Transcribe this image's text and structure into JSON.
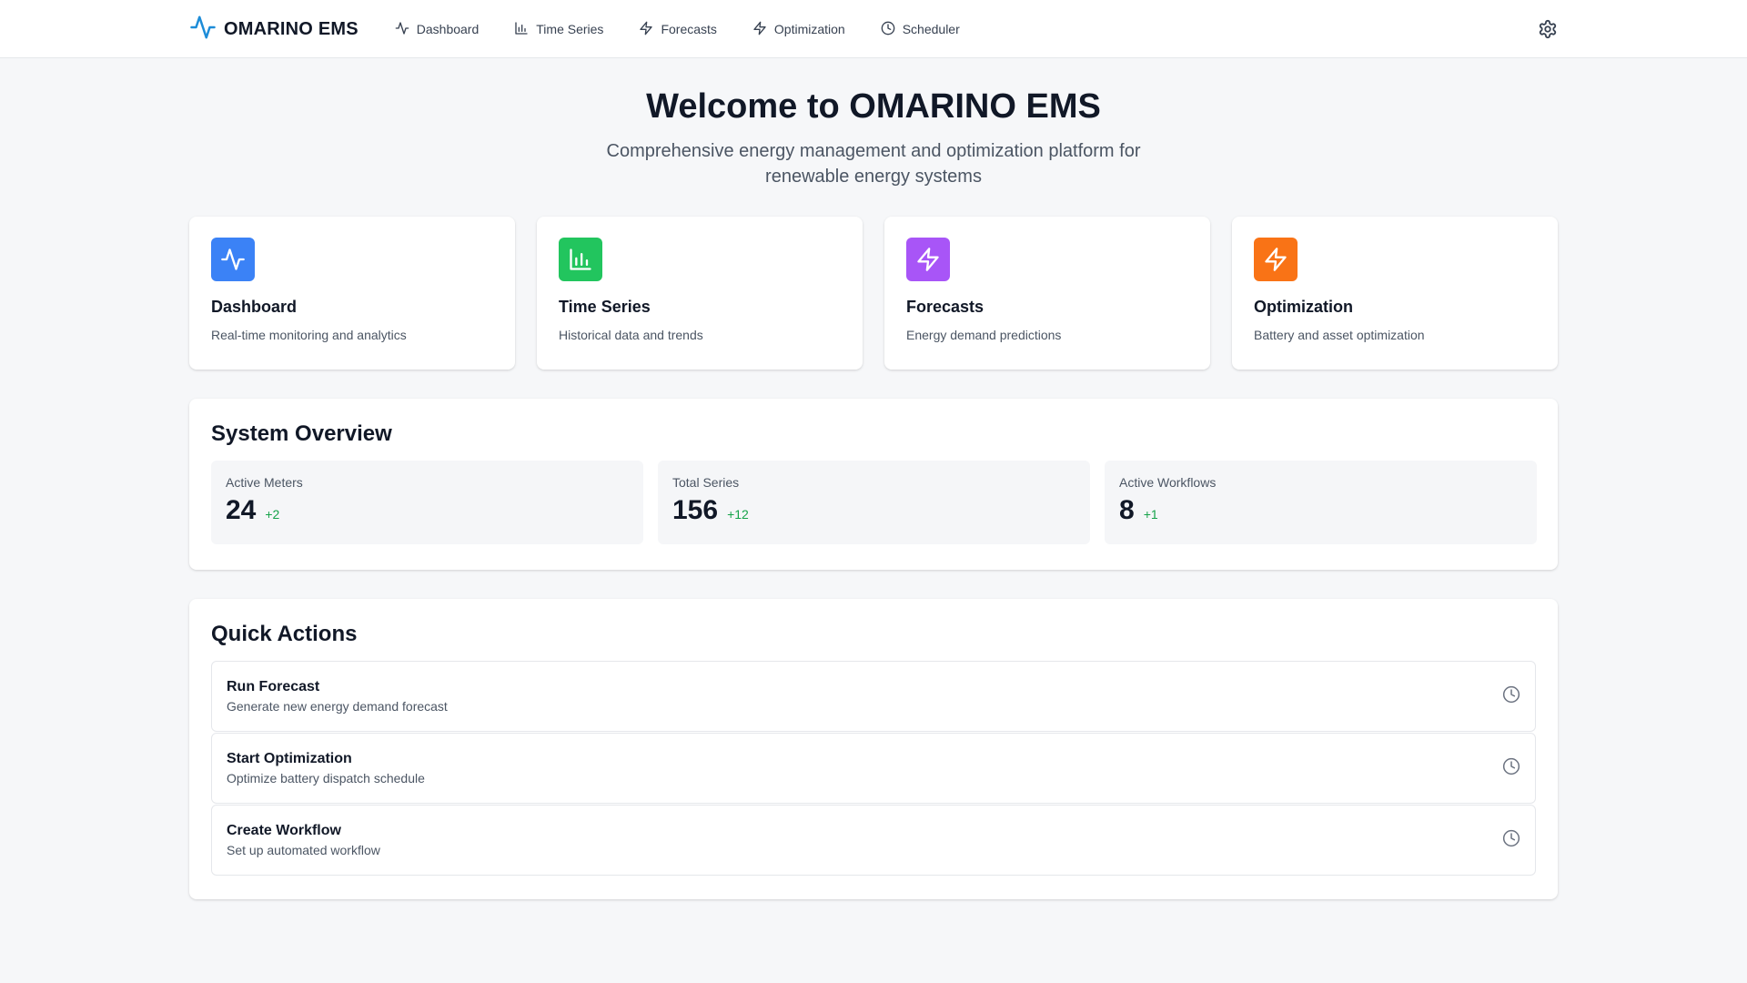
{
  "app": {
    "name": "OMARINO EMS",
    "logo_icon": "activity-icon",
    "accent": "#1d8cd8"
  },
  "nav": {
    "items": [
      {
        "label": "Dashboard",
        "icon": "activity-icon"
      },
      {
        "label": "Time Series",
        "icon": "bar-chart-icon"
      },
      {
        "label": "Forecasts",
        "icon": "zap-icon"
      },
      {
        "label": "Optimization",
        "icon": "zap-icon"
      },
      {
        "label": "Scheduler",
        "icon": "clock-icon"
      }
    ],
    "settings_icon": "gear-icon"
  },
  "hero": {
    "title": "Welcome to OMARINO EMS",
    "subtitle": "Comprehensive energy management and optimization platform for renewable energy systems"
  },
  "features": [
    {
      "title": "Dashboard",
      "description": "Real-time monitoring and analytics",
      "icon": "activity-icon",
      "color": "#3b82f6"
    },
    {
      "title": "Time Series",
      "description": "Historical data and trends",
      "icon": "bar-chart-icon",
      "color": "#22c55e"
    },
    {
      "title": "Forecasts",
      "description": "Energy demand predictions",
      "icon": "zap-icon",
      "color": "#a855f7"
    },
    {
      "title": "Optimization",
      "description": "Battery and asset optimization",
      "icon": "zap-icon",
      "color": "#f97316"
    }
  ],
  "overview": {
    "title": "System Overview",
    "stats": [
      {
        "label": "Active Meters",
        "value": "24",
        "delta": "+2"
      },
      {
        "label": "Total Series",
        "value": "156",
        "delta": "+12"
      },
      {
        "label": "Active Workflows",
        "value": "8",
        "delta": "+1"
      }
    ],
    "delta_color": "#16a34a"
  },
  "quick_actions": {
    "title": "Quick Actions",
    "items": [
      {
        "title": "Run Forecast",
        "description": "Generate new energy demand forecast",
        "icon": "clock-icon"
      },
      {
        "title": "Start Optimization",
        "description": "Optimize battery dispatch schedule",
        "icon": "clock-icon"
      },
      {
        "title": "Create Workflow",
        "description": "Set up automated workflow",
        "icon": "clock-icon"
      }
    ]
  }
}
